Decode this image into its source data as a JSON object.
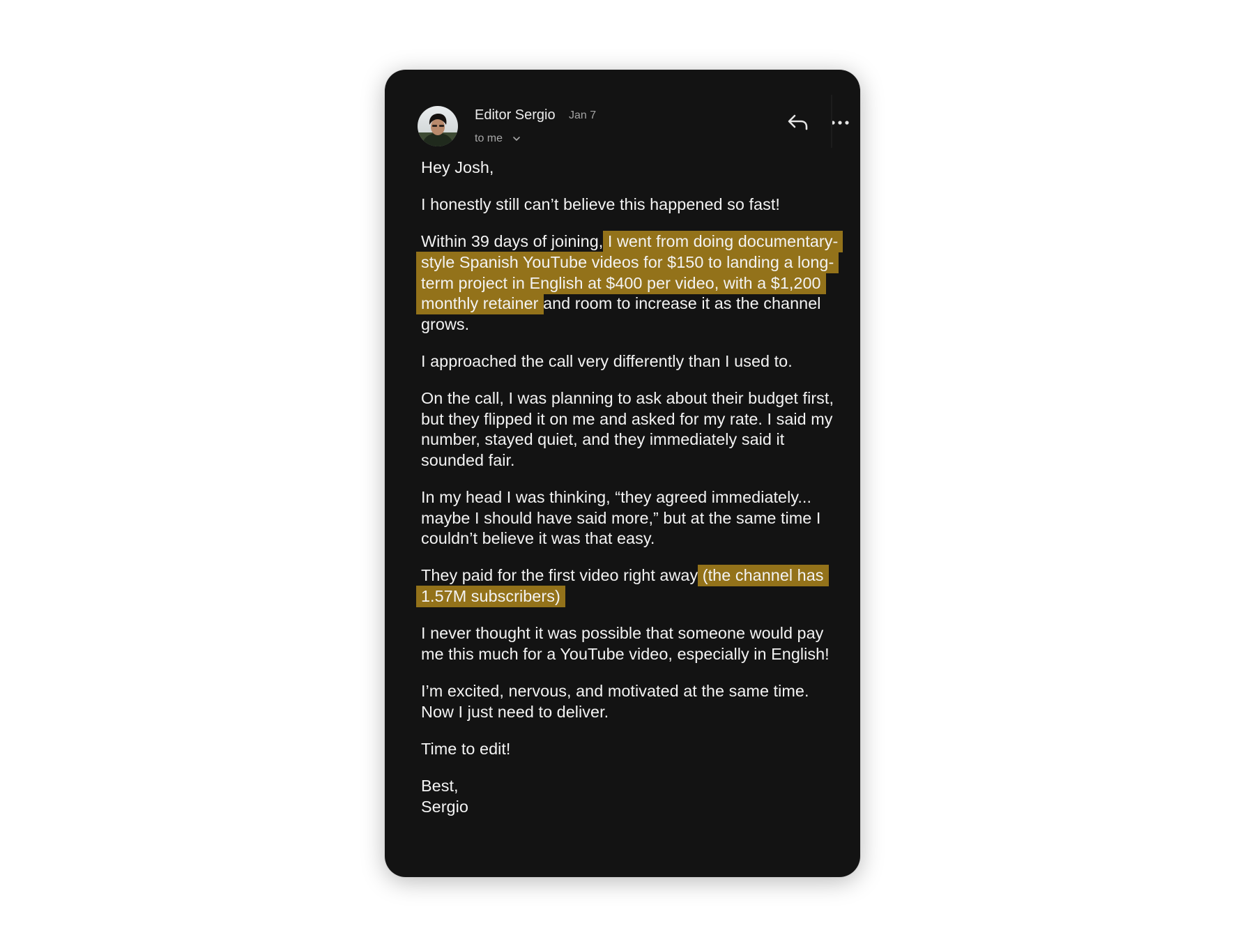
{
  "email": {
    "sender_name": "Editor Sergio",
    "date": "Jan 7",
    "recipient": "to me",
    "avatar_icon": "avatar-photo",
    "actions": {
      "reply_icon": "reply-arrow-icon",
      "more_icon": "more-horizontal-icon"
    },
    "highlight_color": "#93721a",
    "body": {
      "greeting": "Hey Josh,",
      "p1": "I honestly still can’t believe this happened so fast!",
      "p2_start": "Within 39 days of joining, ",
      "p2_highlight": "I went from doing documentary-style Spanish YouTube videos for $150 to landing a long-term project in English at $400 per video, with a $1,200 monthly retainer",
      "p2_end": " and room to increase it as the channel grows.",
      "p3": "I approached the call very differently than I used to.",
      "p4": "On the call, I was planning to ask about their budget first, but they flipped it on me and asked for my rate. I said my number, stayed quiet, and they immediately said it sounded fair.",
      "p5": "In my head I was thinking, “they agreed immediately... maybe I should have said more,” but at the same time I couldn’t believe it was that easy.",
      "p6_start": "They paid for the first video right away ",
      "p6_highlight": "(the channel has 1.57M subscribers)",
      "p7": "I never thought it was possible that someone would pay me this much for a YouTube video, especially in English!",
      "p8": "I’m excited, nervous, and motivated at the same time. Now I just need to deliver.",
      "p9": "Time to edit!",
      "signoff": "Best,",
      "signature": "Sergio"
    }
  }
}
